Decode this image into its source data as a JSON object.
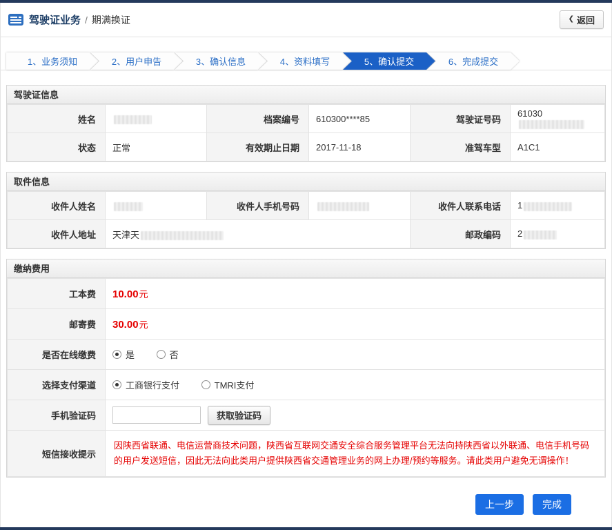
{
  "header": {
    "icon": "license-card-icon",
    "title_main": "驾驶证业务",
    "title_sep": "/",
    "title_sub": "期满换证",
    "back_icon": "❮",
    "back_label": "返回"
  },
  "steps": [
    {
      "label": "1、业务须知",
      "active": false
    },
    {
      "label": "2、用户申告",
      "active": false
    },
    {
      "label": "3、确认信息",
      "active": false
    },
    {
      "label": "4、资料填写",
      "active": false
    },
    {
      "label": "5、确认提交",
      "active": true
    },
    {
      "label": "6、完成提交",
      "active": false
    }
  ],
  "license": {
    "title": "驾驶证信息",
    "name_label": "姓名",
    "name_value": "",
    "file_label": "档案编号",
    "file_value": "610300****85",
    "licno_label": "驾驶证号码",
    "licno_value": "61030",
    "status_label": "状态",
    "status_value": "正常",
    "expire_label": "有效期止日期",
    "expire_value": "2017-11-18",
    "vehicle_label": "准驾车型",
    "vehicle_value": "A1C1"
  },
  "pickup": {
    "title": "取件信息",
    "name_label": "收件人姓名",
    "name_value": "",
    "mobile_label": "收件人手机号码",
    "mobile_value": "",
    "tel_label": "收件人联系电话",
    "tel_value": "1",
    "addr_label": "收件人地址",
    "addr_value": "天津天",
    "post_label": "邮政编码",
    "post_value": "2"
  },
  "fees": {
    "title": "缴纳费用",
    "cost_label": "工本费",
    "cost_value": "10.00",
    "cost_unit": "元",
    "mail_label": "邮寄费",
    "mail_value": "30.00",
    "mail_unit": "元",
    "online_label": "是否在线缴费",
    "yes_label": "是",
    "no_label": "否",
    "channel_label": "选择支付渠道",
    "channel_icbc": "工商银行支付",
    "channel_tmri": "TMRI支付",
    "code_label": "手机验证码",
    "code_value": "",
    "get_code_label": "获取验证码",
    "notice_label": "短信接收提示",
    "notice_text": "因陕西省联通、电信运营商技术问题，陕西省互联网交通安全综合服务管理平台无法向持陕西省以外联通、电信手机号码的用户发送短信，因此无法向此类用户提供陕西省交通管理业务的网上办理/预约等服务。请此类用户避免无谓操作！"
  },
  "footer": {
    "prev_label": "上一步",
    "done_label": "完成"
  },
  "colors": {
    "accent_blue": "#1b60c6",
    "step_text_blue": "#2a6ec6",
    "button_blue": "#1b6ee4",
    "danger_red": "#e50000",
    "navy_bar": "#24395c"
  }
}
